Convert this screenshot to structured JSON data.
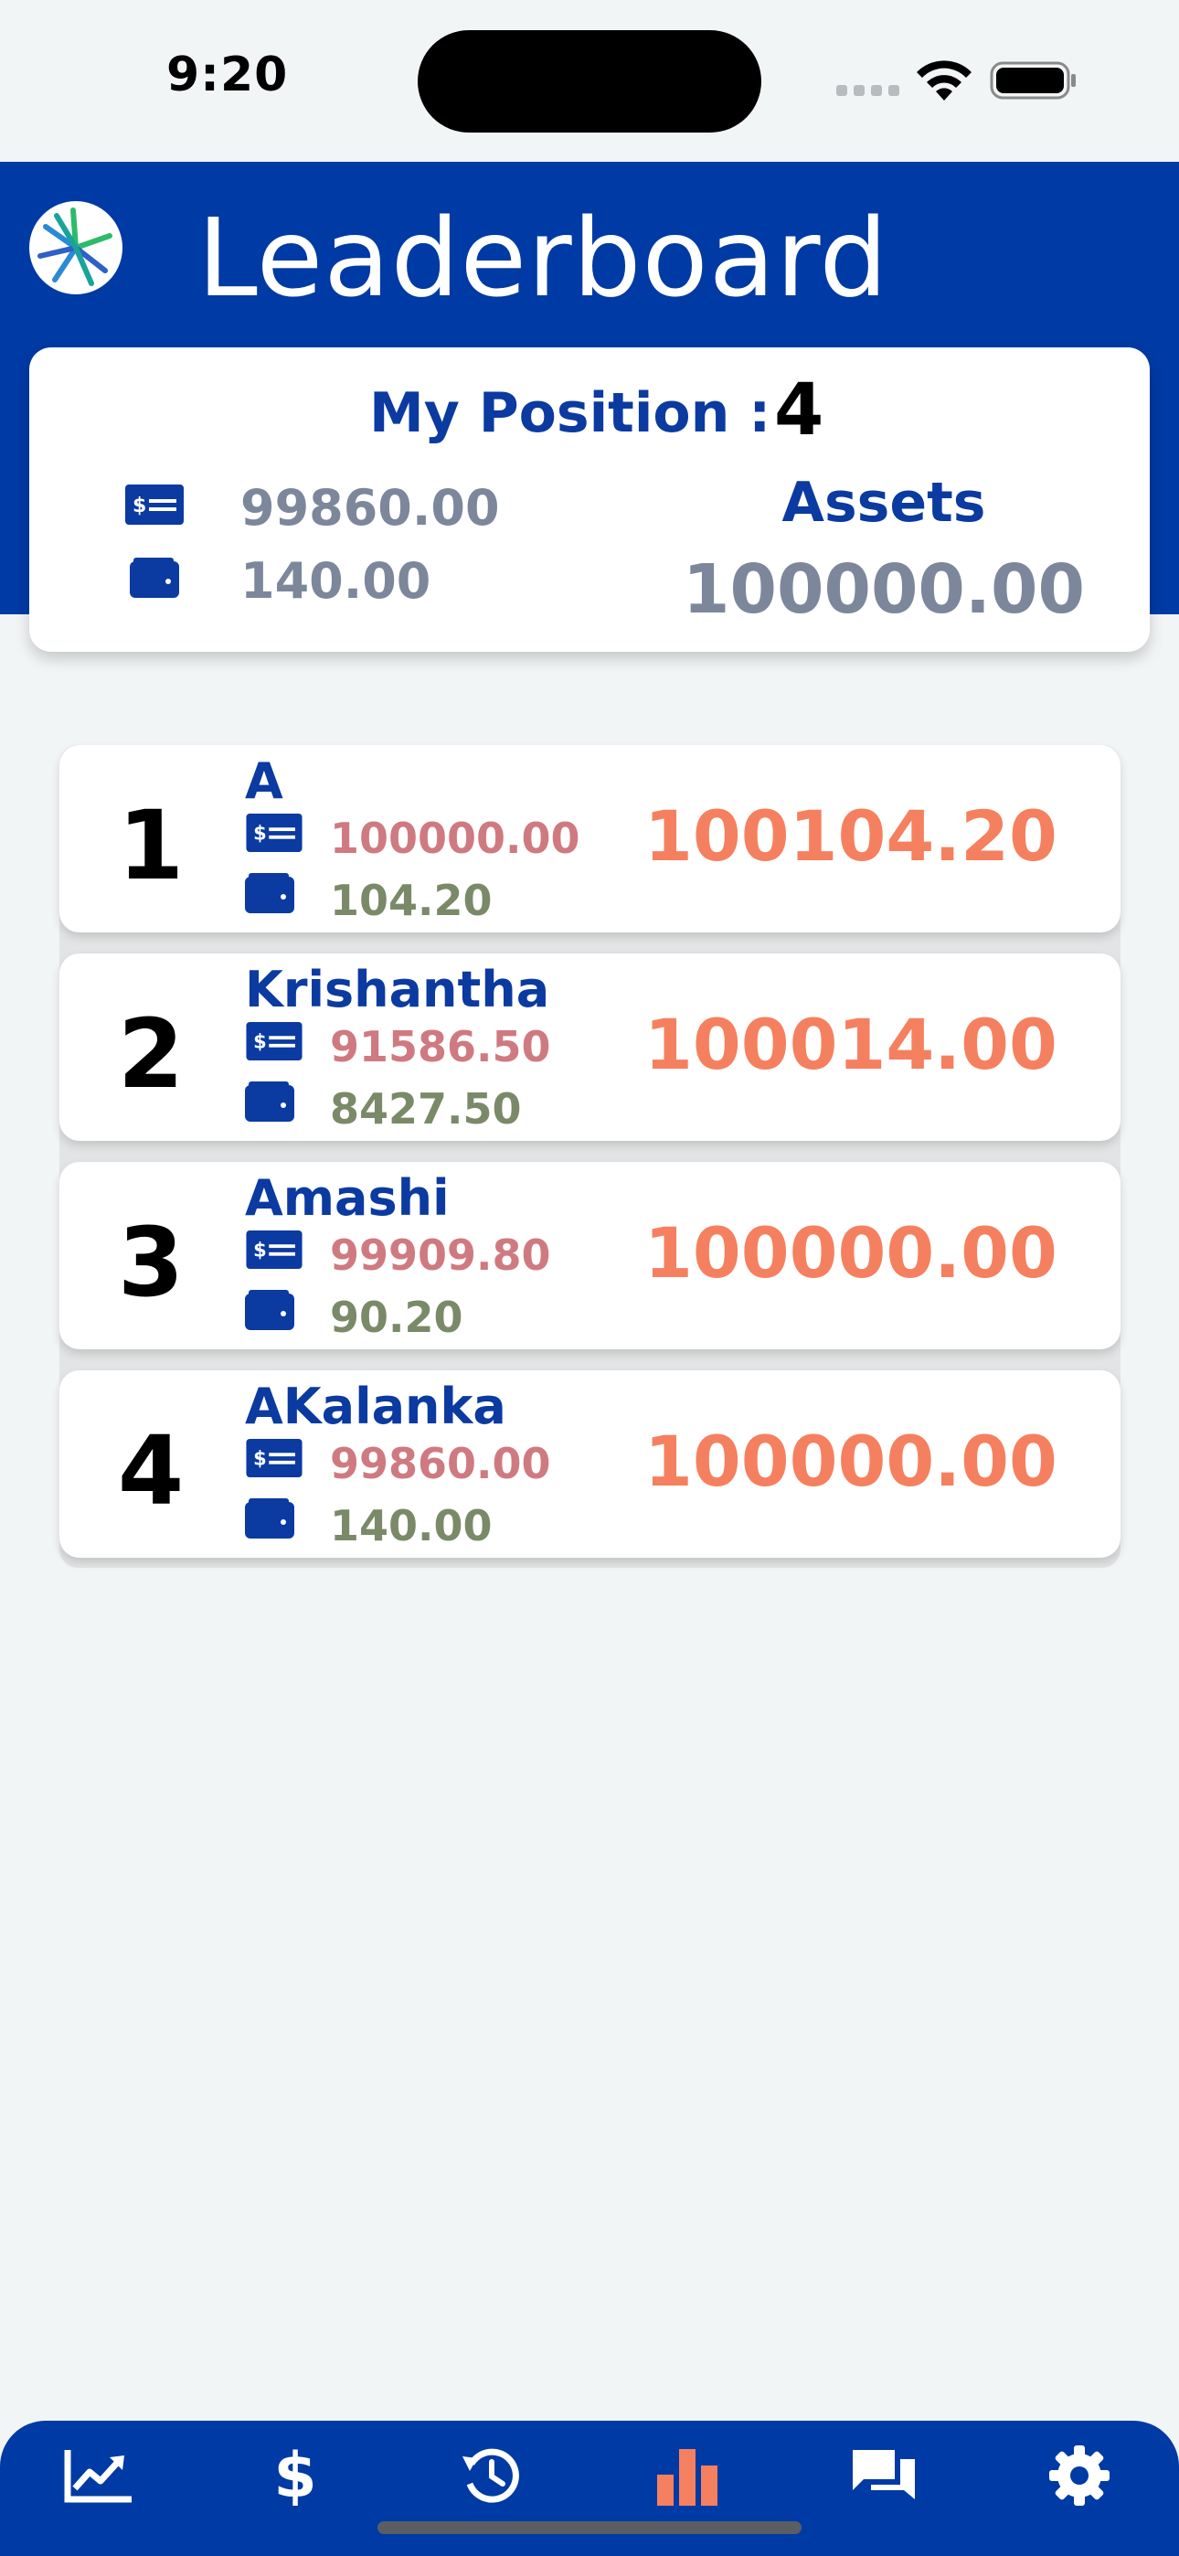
{
  "status_bar": {
    "time": "9:20"
  },
  "header": {
    "title": "Leaderboard"
  },
  "summary": {
    "position_label": "My Position :",
    "position_value": "4",
    "cash": "99860.00",
    "wallet": "140.00",
    "assets_label": "Assets",
    "assets_value": "100000.00"
  },
  "leaderboard": [
    {
      "rank": "1",
      "name": "A",
      "cash": "100000.00",
      "wallet": "104.20",
      "total": "100104.20"
    },
    {
      "rank": "2",
      "name": "Krishantha",
      "cash": "91586.50",
      "wallet": "8427.50",
      "total": "100014.00"
    },
    {
      "rank": "3",
      "name": "Amashi",
      "cash": "99909.80",
      "wallet": "90.20",
      "total": "100000.00"
    },
    {
      "rank": "4",
      "name": "AKalanka",
      "cash": "99860.00",
      "wallet": "140.00",
      "total": "100000.00"
    }
  ],
  "nav": {
    "items": [
      {
        "icon": "chart-line-icon",
        "active": false
      },
      {
        "icon": "dollar-icon",
        "active": false
      },
      {
        "icon": "history-icon",
        "active": false
      },
      {
        "icon": "bar-chart-icon",
        "active": true
      },
      {
        "icon": "chat-icon",
        "active": false
      },
      {
        "icon": "gear-icon",
        "active": false
      }
    ]
  },
  "colors": {
    "primary": "#003aa4",
    "accent": "#f5805f",
    "cash_text": "#cf7a80",
    "wallet_text": "#7a8a68",
    "muted": "#7c879c"
  }
}
